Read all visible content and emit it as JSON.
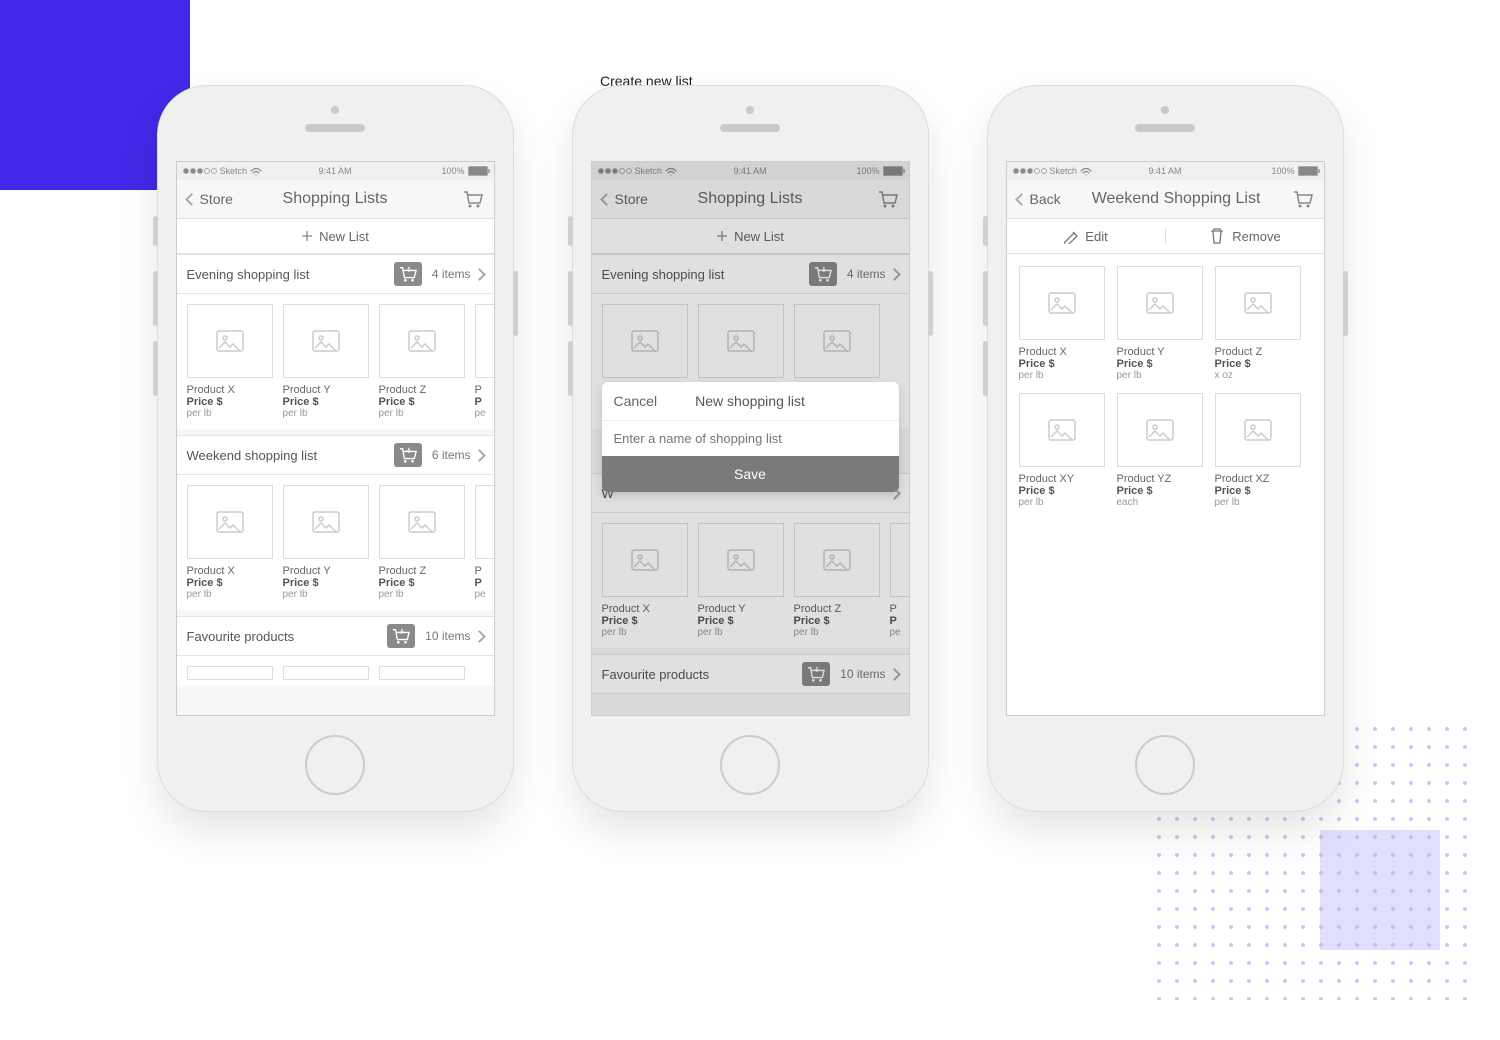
{
  "peek_text": "Create new list",
  "status": {
    "carrier": "Sketch",
    "time": "9:41 AM",
    "battery": "100%"
  },
  "phone1": {
    "back": "Store",
    "title": "Shopping Lists",
    "newlist": "New List",
    "sections": [
      {
        "name": "Evening shopping list",
        "count": "4 items",
        "products": [
          {
            "n": "Product X",
            "p": "Price $",
            "u": "per lb"
          },
          {
            "n": "Product Y",
            "p": "Price $",
            "u": "per lb"
          },
          {
            "n": "Product Z",
            "p": "Price $",
            "u": "per lb"
          },
          {
            "n": "P",
            "p": "P",
            "u": "pe"
          }
        ]
      },
      {
        "name": "Weekend shopping list",
        "count": "6 items",
        "products": [
          {
            "n": "Product X",
            "p": "Price $",
            "u": "per lb"
          },
          {
            "n": "Product Y",
            "p": "Price $",
            "u": "per lb"
          },
          {
            "n": "Product Z",
            "p": "Price $",
            "u": "per lb"
          },
          {
            "n": "P",
            "p": "P",
            "u": "pe"
          }
        ]
      },
      {
        "name": "Favourite products",
        "count": "10 items",
        "products": []
      }
    ]
  },
  "phone2": {
    "back": "Store",
    "title": "Shopping Lists",
    "newlist": "New List",
    "modal": {
      "cancel": "Cancel",
      "title": "New shopping list",
      "placeholder": "Enter a name of shopping list",
      "save": "Save"
    },
    "sections": [
      {
        "name": "Evening shopping list",
        "count": "4 items"
      },
      {
        "name": "W",
        "count": ""
      },
      {
        "name": "Favourite products",
        "count": "10 items"
      }
    ],
    "prods": [
      {
        "n": "Product X",
        "p": "Price $",
        "u": "per lb"
      },
      {
        "n": "Product Y",
        "p": "Price $",
        "u": "per lb"
      },
      {
        "n": "Product Z",
        "p": "Price $",
        "u": "per lb"
      },
      {
        "n": "P",
        "p": "P",
        "u": "pe"
      }
    ]
  },
  "phone3": {
    "back": "Back",
    "title": "Weekend Shopping List",
    "edit": "Edit",
    "remove": "Remove",
    "products": [
      {
        "n": "Product X",
        "p": "Price $",
        "u": "per lb"
      },
      {
        "n": "Product Y",
        "p": "Price $",
        "u": "per lb"
      },
      {
        "n": "Product Z",
        "p": "Price $",
        "u": "x oz"
      },
      {
        "n": "Product XY",
        "p": "Price $",
        "u": "per lb"
      },
      {
        "n": "Product YZ",
        "p": "Price $",
        "u": "each"
      },
      {
        "n": "Product XZ",
        "p": "Price $",
        "u": "per lb"
      }
    ]
  }
}
